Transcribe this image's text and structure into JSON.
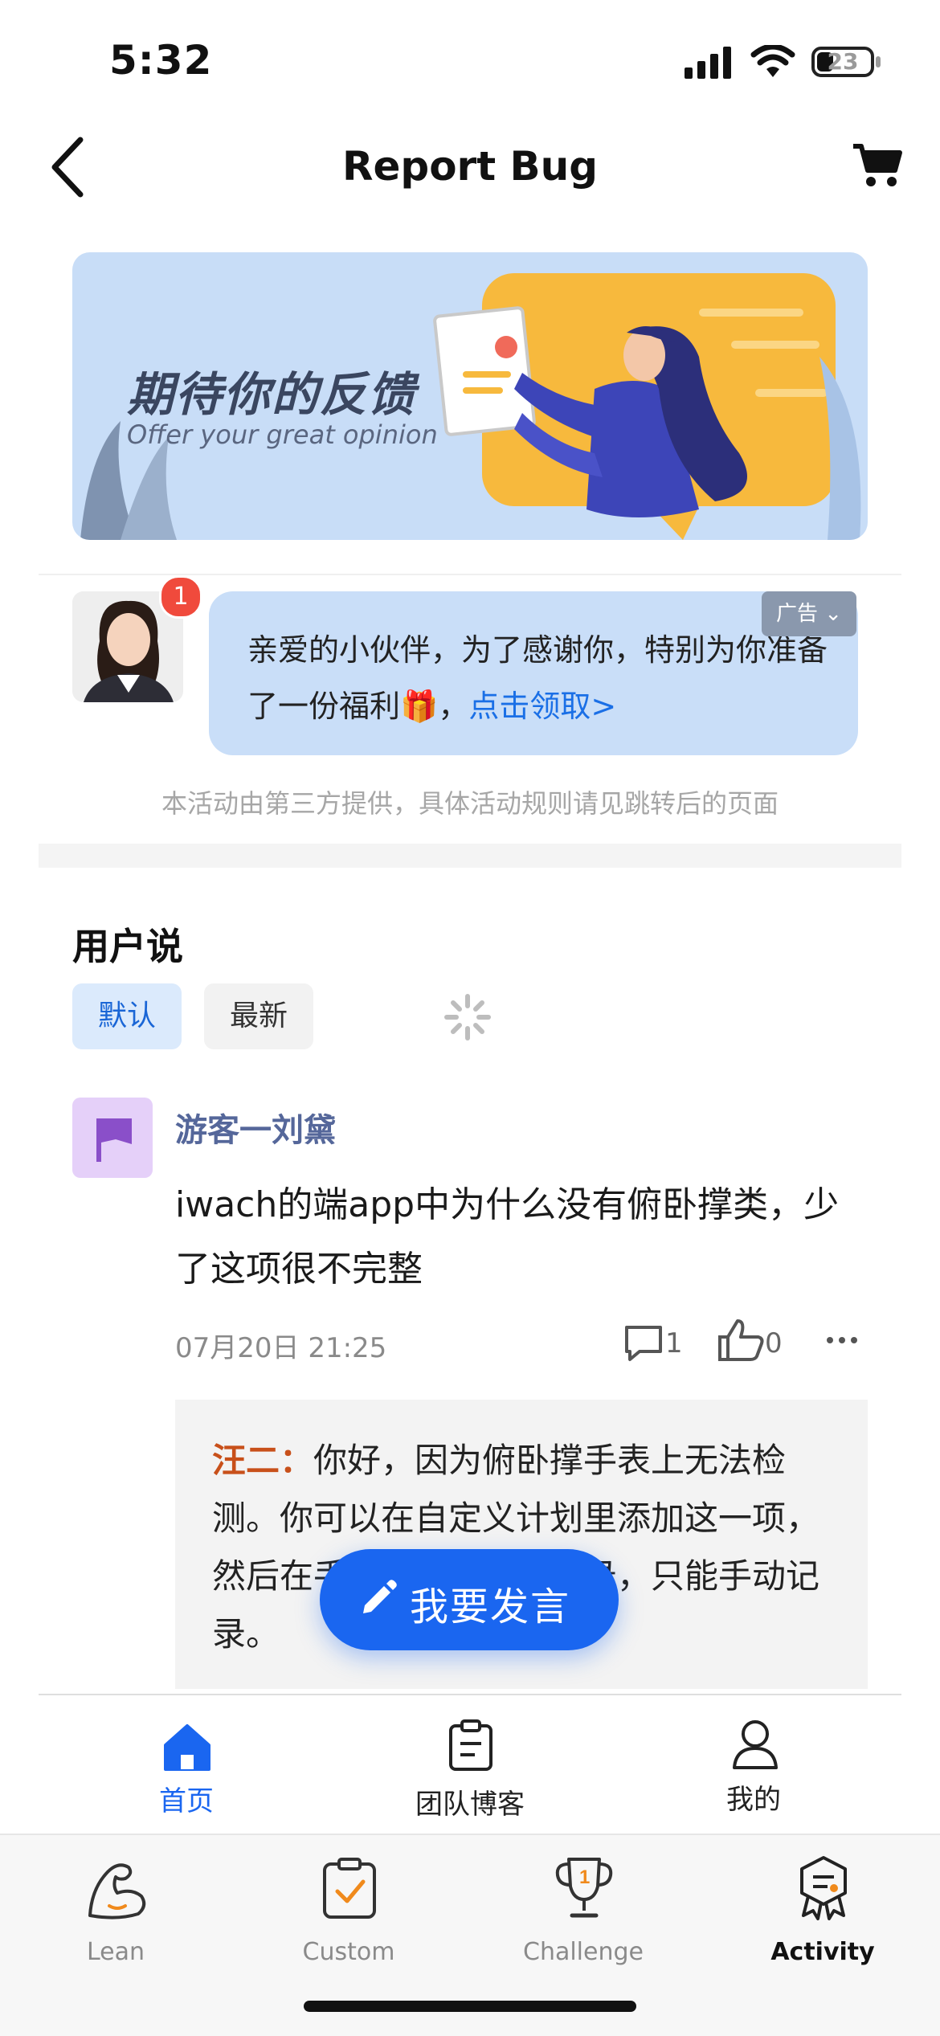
{
  "status_bar": {
    "time": "5:32",
    "battery": "23"
  },
  "nav": {
    "title": "Report Bug"
  },
  "banner": {
    "title": "期待你的反馈",
    "subtitle": "Offer your great opinion"
  },
  "ad": {
    "badge_count": "1",
    "tag": "广告",
    "text": "亲爱的小伙伴，为了感谢你，特别为你准备了一份福利🎁，",
    "link": "点击领取>",
    "disclaimer": "本活动由第三方提供，具体活动规则请见跳转后的页面"
  },
  "section": {
    "title": "用户说",
    "filters": {
      "default": "默认",
      "latest": "最新"
    }
  },
  "post": {
    "author": "游客一刘黛",
    "body": "iwach的端app中为什么没有俯卧撑类，少了这项很不完整",
    "time": "07月20日 21:25",
    "comment_count": "1",
    "like_count": "0",
    "reply": {
      "name": "汪二：",
      "text": "你好，因为俯卧撑手表上无法检测。你可以在自定义计划里添加这一项，然后在手表上无法自动记录，只能手动记录。"
    }
  },
  "speak_button": {
    "label": "我要发言"
  },
  "inner_tabs": [
    {
      "label": "首页",
      "active": true
    },
    {
      "label": "团队博客",
      "active": false
    },
    {
      "label": "我的",
      "active": false
    }
  ],
  "outer_tabs": [
    {
      "label": "Lean",
      "active": false
    },
    {
      "label": "Custom",
      "active": false
    },
    {
      "label": "Challenge",
      "active": false
    },
    {
      "label": "Activity",
      "active": true
    }
  ],
  "colors": {
    "accent": "#1a66f0",
    "reply_name": "#c8501a",
    "author": "#55679a"
  }
}
